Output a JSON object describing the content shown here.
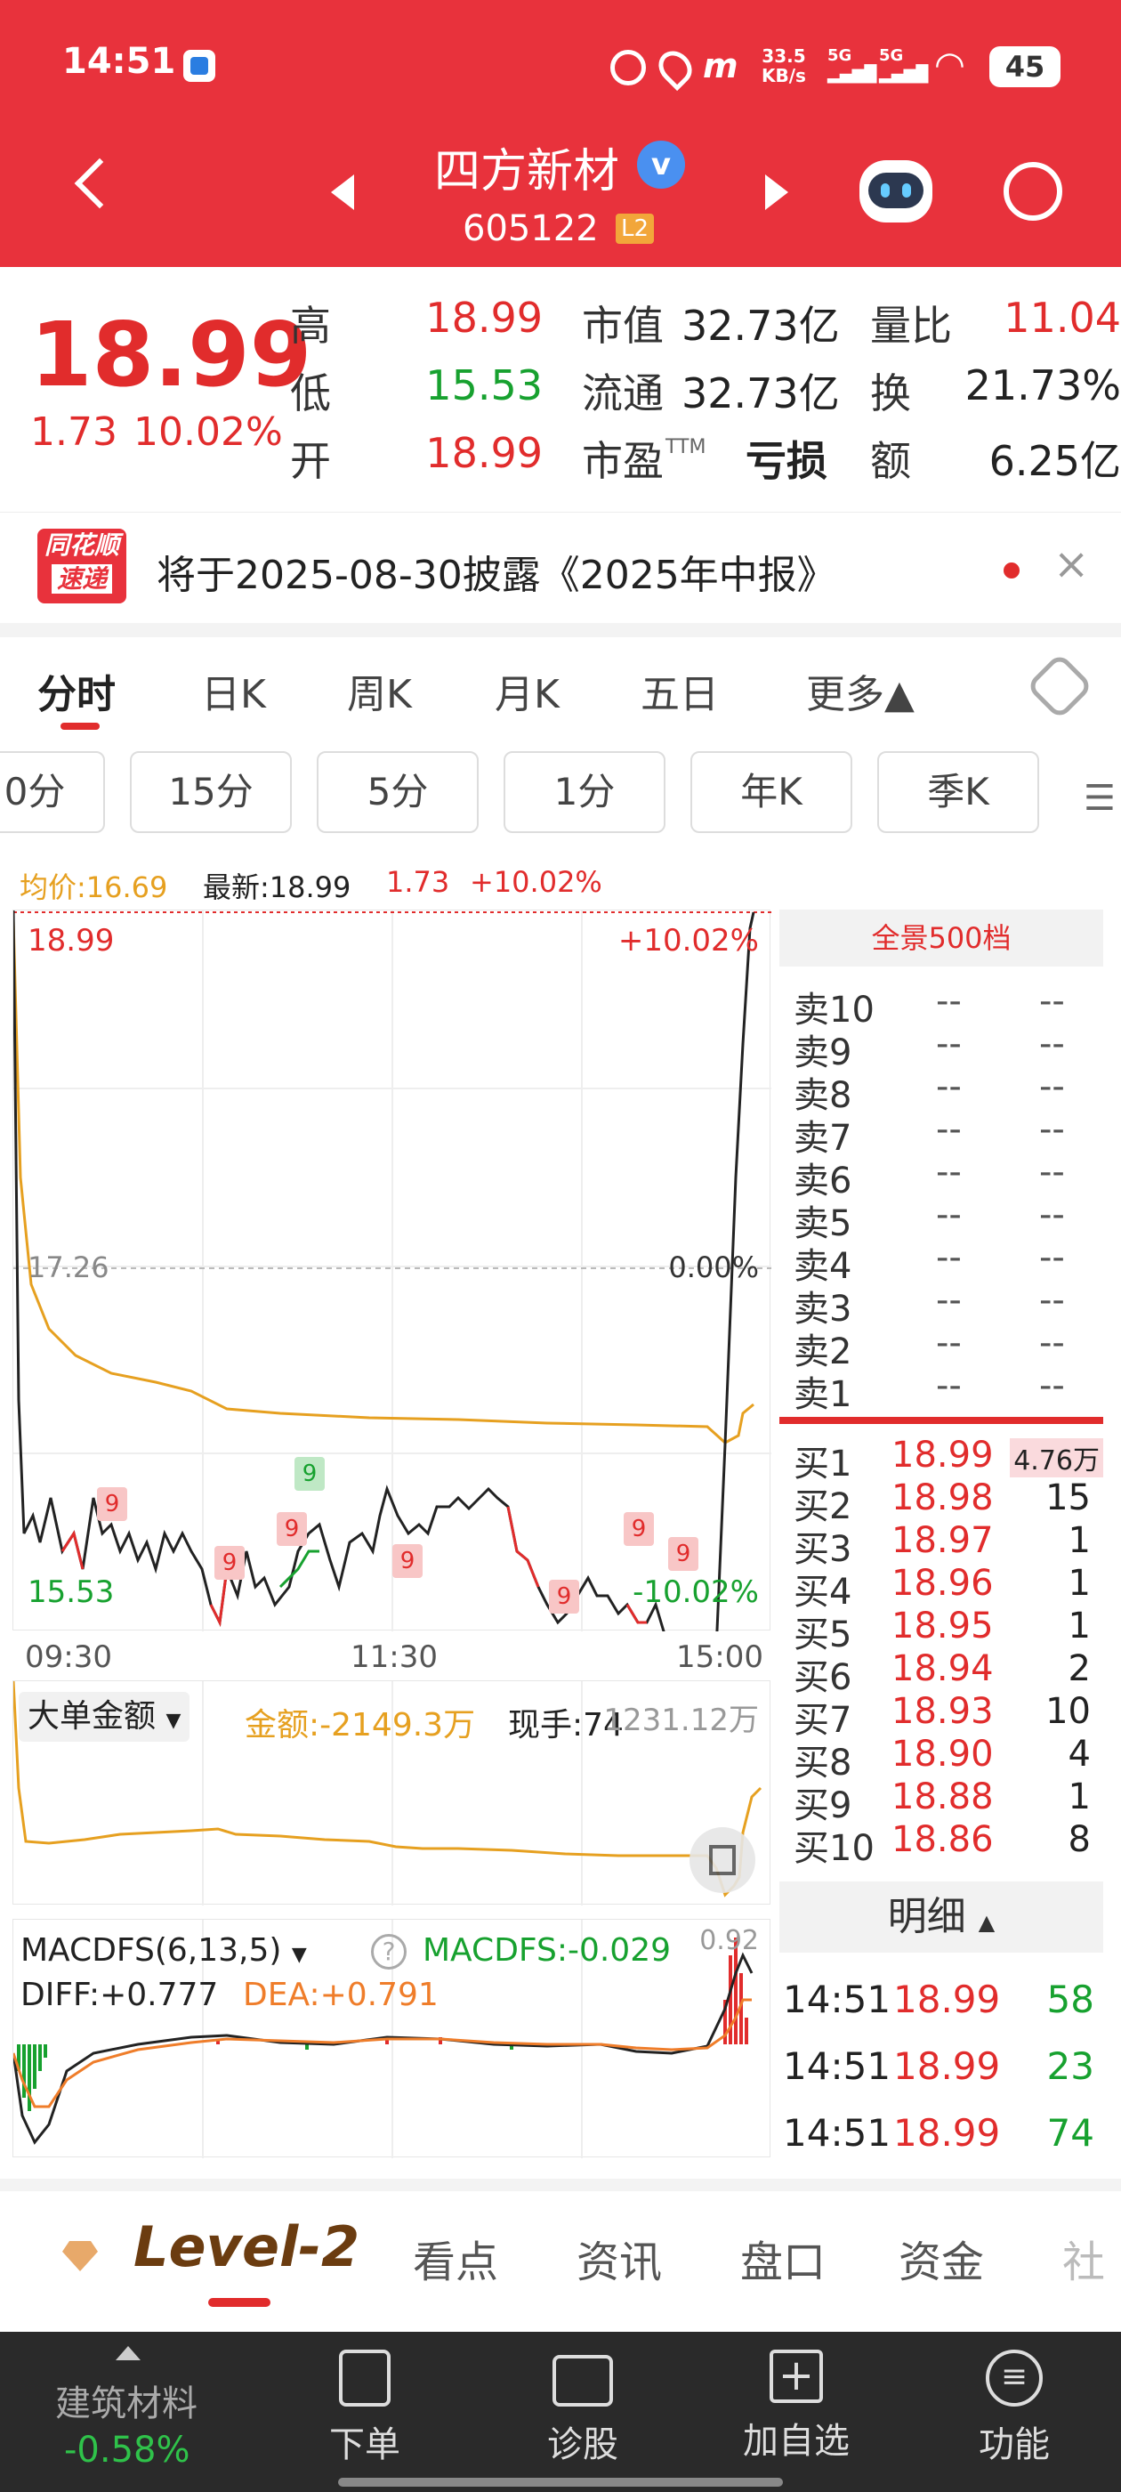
{
  "status_bar": {
    "time": "14:51",
    "speed": "33.5",
    "speed_unit": "KB/s",
    "net1": "5G",
    "net2": "5G",
    "battery": "45"
  },
  "header": {
    "stock_name": "四方新材",
    "stock_code": "605122",
    "level_badge": "L2"
  },
  "quote": {
    "price": "18.99",
    "change": "1.73",
    "change_pct": "10.02%",
    "high_label": "高",
    "high": "18.99",
    "low_label": "低",
    "low": "15.53",
    "open_label": "开",
    "open": "18.99",
    "mktcap_label": "市值",
    "mktcap": "32.73亿",
    "float_label": "流通",
    "float": "32.73亿",
    "pe_label": "市盈",
    "pe_sup": "TTM",
    "pe": "亏损",
    "vol_ratio_label": "量比",
    "vol_ratio": "11.04",
    "turnover_label": "换",
    "turnover": "21.73%",
    "amount_label": "额",
    "amount": "6.25亿"
  },
  "notice": {
    "logo_top": "同花顺",
    "logo_bottom": "速递",
    "text": "将于2025-08-30披露《2025年中报》",
    "close": "×"
  },
  "tabs": [
    {
      "label": "分时",
      "active": true
    },
    {
      "label": "日K"
    },
    {
      "label": "周K"
    },
    {
      "label": "月K"
    },
    {
      "label": "五日"
    },
    {
      "label": "更多▲"
    }
  ],
  "periods": [
    "0分",
    "15分",
    "5分",
    "1分",
    "年K",
    "季K"
  ],
  "info_bar": {
    "avg": "均价:16.69",
    "latest": "最新:18.99",
    "chg": "1.73",
    "chg_pct": "+10.02%"
  },
  "main_chart": {
    "top_left": "18.99",
    "top_right": "+10.02%",
    "mid_left": "17.26",
    "mid_right": "0.00%",
    "bottom_left": "15.53",
    "bottom_right": "-10.02%",
    "x_ticks": [
      "09:30",
      "11:30",
      "15:00"
    ],
    "marker": "9"
  },
  "flow_chart": {
    "selector": "大单金额",
    "amount": "金额:-2149.3万",
    "hand": "现手:74",
    "right": "1231.12万"
  },
  "macd_chart": {
    "selector": "MACDFS(6,13,5)",
    "help": "?",
    "macdfs": "MACDFS:-0.029",
    "diff": "DIFF:+0.777",
    "dea": "DEA:+0.791",
    "right": "0.92"
  },
  "orderbook": {
    "title": "全景500档",
    "asks": [
      {
        "label": "卖10",
        "price": "--",
        "vol": "--"
      },
      {
        "label": "卖9",
        "price": "--",
        "vol": "--"
      },
      {
        "label": "卖8",
        "price": "--",
        "vol": "--"
      },
      {
        "label": "卖7",
        "price": "--",
        "vol": "--"
      },
      {
        "label": "卖6",
        "price": "--",
        "vol": "--"
      },
      {
        "label": "卖5",
        "price": "--",
        "vol": "--"
      },
      {
        "label": "卖4",
        "price": "--",
        "vol": "--"
      },
      {
        "label": "卖3",
        "price": "--",
        "vol": "--"
      },
      {
        "label": "卖2",
        "price": "--",
        "vol": "--"
      },
      {
        "label": "卖1",
        "price": "--",
        "vol": "--"
      }
    ],
    "bids": [
      {
        "label": "买1",
        "price": "18.99",
        "vol": "4.76万"
      },
      {
        "label": "买2",
        "price": "18.98",
        "vol": "15"
      },
      {
        "label": "买3",
        "price": "18.97",
        "vol": "1"
      },
      {
        "label": "买4",
        "price": "18.96",
        "vol": "1"
      },
      {
        "label": "买5",
        "price": "18.95",
        "vol": "1"
      },
      {
        "label": "买6",
        "price": "18.94",
        "vol": "2"
      },
      {
        "label": "买7",
        "price": "18.93",
        "vol": "10"
      },
      {
        "label": "买8",
        "price": "18.90",
        "vol": "4"
      },
      {
        "label": "买9",
        "price": "18.88",
        "vol": "1"
      },
      {
        "label": "买10",
        "price": "18.86",
        "vol": "8"
      }
    ],
    "detail_title": "明细",
    "trades": [
      {
        "time": "14:51",
        "price": "18.99",
        "vol": "58"
      },
      {
        "time": "14:51",
        "price": "18.99",
        "vol": "23"
      },
      {
        "time": "14:51",
        "price": "18.99",
        "vol": "74"
      }
    ]
  },
  "bottom_tabs": [
    "Level-2",
    "看点",
    "资讯",
    "盘口",
    "资金",
    "社"
  ],
  "bottom_nav": {
    "sector_name": "建筑材料",
    "sector_change": "-0.58%",
    "items": [
      {
        "label": "下单"
      },
      {
        "label": "诊股"
      },
      {
        "label": "加自选"
      },
      {
        "label": "功能"
      }
    ]
  }
}
